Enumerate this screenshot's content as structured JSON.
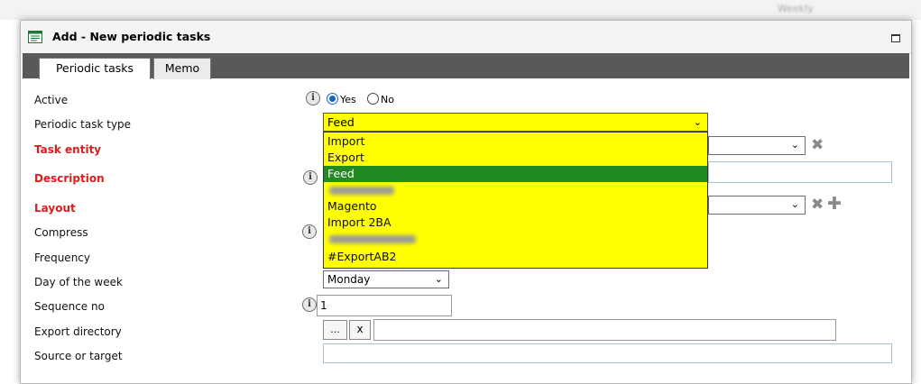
{
  "window": {
    "title": "Add - New periodic tasks"
  },
  "tabs": [
    {
      "label": "Periodic tasks"
    },
    {
      "label": "Memo"
    }
  ],
  "background": {
    "top_right_text": "Weekly"
  },
  "form": {
    "active": {
      "label": "Active",
      "yes": "Yes",
      "no": "No",
      "selected": "Yes"
    },
    "task_type": {
      "label": "Periodic task type",
      "value": "Feed",
      "options": [
        "Import",
        "Export",
        "Feed",
        "Magento",
        "Import 2BA",
        "#ExportAB2"
      ]
    },
    "task_entity": {
      "label": "Task entity"
    },
    "description": {
      "label": "Description",
      "value": ""
    },
    "layout": {
      "label": "Layout"
    },
    "compress": {
      "label": "Compress"
    },
    "frequency": {
      "label": "Frequency"
    },
    "day_of_week": {
      "label": "Day of the week",
      "value": "Monday"
    },
    "sequence_no": {
      "label": "Sequence no",
      "value": "1"
    },
    "export_directory": {
      "label": "Export directory",
      "browse": "...",
      "clear": "x",
      "value": ""
    },
    "source_or_target": {
      "label": "Source or target",
      "value": ""
    }
  },
  "icons": {
    "info": "i",
    "chevron": "⌄",
    "remove": "✖",
    "add": "✚"
  },
  "colors": {
    "required_label": "#e01b1b",
    "dropdown_bg": "#ffff00",
    "dropdown_selected": "#218a21",
    "tabbar": "#595959"
  }
}
